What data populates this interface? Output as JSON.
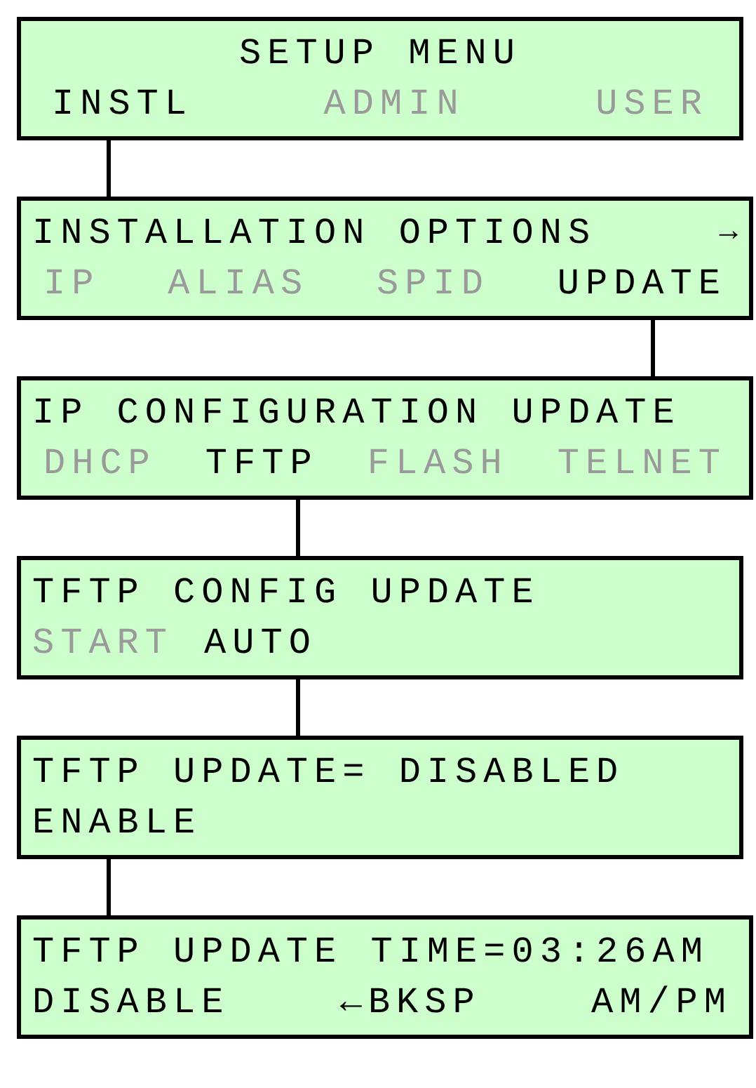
{
  "screens": [
    {
      "kind": "header",
      "title": "SETUP MENU",
      "softkeys": [
        {
          "label": "INSTL",
          "active": true
        },
        {
          "label": "ADMIN",
          "active": false
        },
        {
          "label": "USER",
          "active": false
        }
      ]
    },
    {
      "kind": "menu",
      "title": "INSTALLATION OPTIONS",
      "arrow": "→",
      "softkeys": [
        {
          "label": "IP",
          "active": false
        },
        {
          "label": "ALIAS",
          "active": false
        },
        {
          "label": "SPID",
          "active": false
        },
        {
          "label": "UPDATE",
          "active": true
        }
      ]
    },
    {
      "kind": "menu",
      "title": "IP CONFIGURATION UPDATE",
      "softkeys": [
        {
          "label": "DHCP",
          "active": false
        },
        {
          "label": "TFTP",
          "active": true
        },
        {
          "label": "FLASH",
          "active": false
        },
        {
          "label": "TELNET",
          "active": false
        }
      ]
    },
    {
      "kind": "menu",
      "title": "TFTP CONFIG UPDATE",
      "softkeys": [
        {
          "label": "START",
          "active": false
        },
        {
          "label": "AUTO",
          "active": true
        }
      ]
    },
    {
      "kind": "menu",
      "title": "TFTP UPDATE= DISABLED",
      "softkeys": [
        {
          "label": "ENABLE",
          "active": true
        }
      ]
    },
    {
      "kind": "menu",
      "title": "TFTP UPDATE TIME=03:26AM",
      "softkeys": [
        {
          "label": "DISABLE",
          "active": true
        },
        {
          "label": "←BKSP",
          "active": true
        },
        {
          "label": "AM/PM",
          "active": true
        }
      ]
    }
  ]
}
